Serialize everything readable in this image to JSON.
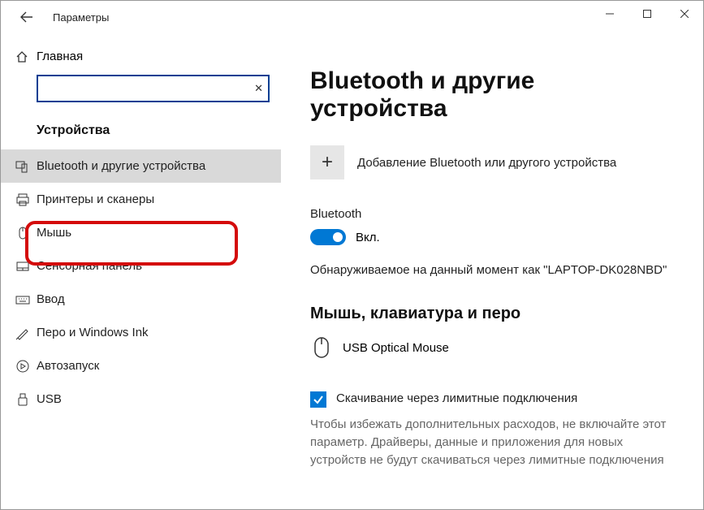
{
  "window": {
    "title": "Параметры"
  },
  "sidebar": {
    "home": "Главная",
    "searchPlaceholder": "",
    "section": "Устройства",
    "items": [
      {
        "label": "Bluetooth и другие устройства"
      },
      {
        "label": "Принтеры и сканеры"
      },
      {
        "label": "Мышь"
      },
      {
        "label": "Сенсорная панель"
      },
      {
        "label": "Ввод"
      },
      {
        "label": "Перо и Windows Ink"
      },
      {
        "label": "Автозапуск"
      },
      {
        "label": "USB"
      }
    ]
  },
  "main": {
    "title": "Bluetooth и другие устройства",
    "addLabel": "Добавление Bluetooth или другого устройства",
    "btLabel": "Bluetooth",
    "toggleState": "Вкл.",
    "discoverable": "Обнаруживаемое на данный момент как \"LAPTOP-DK028NBD\"",
    "sectionMouse": "Мышь, клавиатура и перо",
    "deviceName": "USB Optical Mouse",
    "meteredLabel": "Скачивание через лимитные подключения",
    "meteredDesc": "Чтобы избежать дополнительных расходов, не включайте этот параметр. Драйверы, данные и приложения для новых устройств не будут скачиваться через лимитные подключения"
  }
}
